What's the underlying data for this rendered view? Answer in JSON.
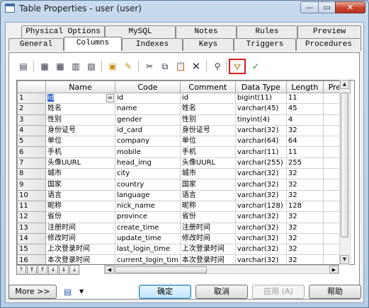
{
  "window": {
    "title": "Table Properties - user (user)",
    "min_label": "—",
    "max_label": "▭",
    "close_label": "✕"
  },
  "tabs_back": [
    "Physical Options",
    "MySQL",
    "Notes",
    "Rules",
    "Preview"
  ],
  "tabs_front": [
    "General",
    "Columns",
    "Indexes",
    "Keys",
    "Triggers",
    "Procedures"
  ],
  "active_tab": "Columns",
  "toolbar_icons": [
    "properties-icon",
    "insert-row-icon",
    "add-row-icon",
    "add-rows-icon",
    "copy-rows-icon",
    "new-column-icon",
    "add-columns-icon",
    "cut-icon",
    "copy-icon",
    "paste-icon",
    "delete-icon",
    "find-icon",
    "filter-icon",
    "customize-columns-icon"
  ],
  "columns": {
    "headers": [
      "Name",
      "Code",
      "Comment",
      "Data Type",
      "Length",
      "Prec"
    ],
    "rows": [
      {
        "num": "1",
        "name": "id",
        "code": "id",
        "comment": "id",
        "type": "bigint(11)",
        "length": "11"
      },
      {
        "num": "2",
        "name": "姓名",
        "code": "name",
        "comment": "姓名",
        "type": "varchar(45)",
        "length": "45"
      },
      {
        "num": "3",
        "name": "性别",
        "code": "gender",
        "comment": "性别",
        "type": "tinyint(4)",
        "length": "4"
      },
      {
        "num": "4",
        "name": "身份证号",
        "code": "id_card",
        "comment": "身份证号",
        "type": "varchar(32)",
        "length": "32"
      },
      {
        "num": "5",
        "name": "单位",
        "code": "company",
        "comment": "单位",
        "type": "varchar(64)",
        "length": "64"
      },
      {
        "num": "6",
        "name": "手机",
        "code": "mobile",
        "comment": "手机",
        "type": "varchar(11)",
        "length": "11"
      },
      {
        "num": "7",
        "name": "头像UURL",
        "code": "head_img",
        "comment": "头像UURL",
        "type": "varchar(255)",
        "length": "255"
      },
      {
        "num": "8",
        "name": "城市",
        "code": "city",
        "comment": "城市",
        "type": "varchar(32)",
        "length": "32"
      },
      {
        "num": "9",
        "name": "国家",
        "code": "country",
        "comment": "国家",
        "type": "varchar(32)",
        "length": "32"
      },
      {
        "num": "10",
        "name": "语言",
        "code": "language",
        "comment": "语言",
        "type": "varchar(32)",
        "length": "32"
      },
      {
        "num": "11",
        "name": "昵称",
        "code": "nick_name",
        "comment": "昵称",
        "type": "varchar(128)",
        "length": "128"
      },
      {
        "num": "12",
        "name": "省份",
        "code": "province",
        "comment": "省份",
        "type": "varchar(32)",
        "length": "32"
      },
      {
        "num": "13",
        "name": "注册时间",
        "code": "create_time",
        "comment": "注册时间",
        "type": "varchar(32)",
        "length": "32"
      },
      {
        "num": "14",
        "name": "修改时间",
        "code": "update_time",
        "comment": "修改时间",
        "type": "varchar(32)",
        "length": "32"
      },
      {
        "num": "15",
        "name": "上次登录时间",
        "code": "last_login_time",
        "comment": "上次登录时间",
        "type": "varchar(32)",
        "length": "32"
      },
      {
        "num": "16",
        "name": "本次登录时间",
        "code": "current_login_tim",
        "comment": "本次登录时间",
        "type": "varchar(32)",
        "length": "32"
      }
    ],
    "selected_cell_button": "="
  },
  "nav_buttons": [
    "⤒",
    "⇑",
    "↑",
    "↓",
    "⇓",
    "⤓"
  ],
  "footer": {
    "more": "More >>",
    "ok": "确定",
    "cancel": "取消",
    "apply": "应用 (A)",
    "help": "帮助"
  }
}
